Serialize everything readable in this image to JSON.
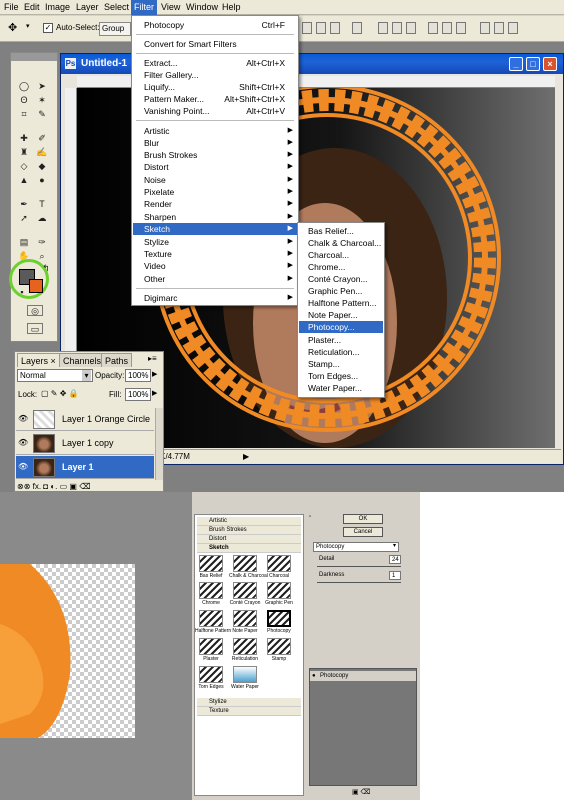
{
  "menubar": {
    "items": [
      "File",
      "Edit",
      "Image",
      "Layer",
      "Select",
      "Filter",
      "View",
      "Window",
      "Help"
    ],
    "active": "Filter"
  },
  "options": {
    "auto_select_label": "Auto-Select:",
    "auto_select_checked": true,
    "group_value": "Group"
  },
  "document": {
    "title": "Untitled-1",
    "status": "2.1K/4.77M"
  },
  "filter_menu": {
    "top": [
      {
        "label": "Photocopy",
        "shortcut": "Ctrl+F"
      },
      {
        "label": "Convert for Smart Filters",
        "shortcut": ""
      },
      {
        "label": "Extract...",
        "shortcut": "Alt+Ctrl+X"
      },
      {
        "label": "Filter Gallery...",
        "shortcut": ""
      },
      {
        "label": "Liquify...",
        "shortcut": "Shift+Ctrl+X"
      },
      {
        "label": "Pattern Maker...",
        "shortcut": "Alt+Shift+Ctrl+X"
      },
      {
        "label": "Vanishing Point...",
        "shortcut": "Alt+Ctrl+V"
      }
    ],
    "groups": [
      "Artistic",
      "Blur",
      "Brush Strokes",
      "Distort",
      "Noise",
      "Pixelate",
      "Render",
      "Sharpen",
      "Sketch",
      "Stylize",
      "Texture",
      "Video",
      "Other"
    ],
    "highlighted": "Sketch",
    "bottom": "Digimarc"
  },
  "sketch_submenu": {
    "items": [
      "Bas Relief...",
      "Chalk & Charcoal...",
      "Charcoal...",
      "Chrome...",
      "Conté Crayon...",
      "Graphic Pen...",
      "Halftone Pattern...",
      "Note Paper...",
      "Photocopy...",
      "Plaster...",
      "Reticulation...",
      "Stamp...",
      "Torn Edges...",
      "Water Paper..."
    ],
    "highlighted": "Photocopy..."
  },
  "layers_panel": {
    "tabs": [
      "Layers ×",
      "Channels",
      "Paths"
    ],
    "blend_mode": "Normal",
    "opacity_label": "Opacity:",
    "opacity": "100%",
    "lock_label": "Lock:",
    "fill_label": "Fill:",
    "fill": "100%",
    "layers": [
      {
        "name": "Layer 1 Orange Circle",
        "selected": false
      },
      {
        "name": "Layer 1 copy",
        "selected": false
      },
      {
        "name": "Layer 1",
        "selected": true
      }
    ],
    "footer_icons": "⊗⊗ fx. ◘ ◐. ▭ ▣ ⌫"
  },
  "gallery": {
    "categories_top": [
      "Artistic",
      "Brush Strokes",
      "Distort",
      "Sketch"
    ],
    "categories_bottom": [
      "Stylize",
      "Texture"
    ],
    "thumbs": [
      "Bas Relief",
      "Chalk & Charcoal",
      "Charcoal",
      "Chrome",
      "Conté Crayon",
      "Graphic Pen",
      "Halftone Pattern",
      "Note Paper",
      "Photocopy",
      "Plaster",
      "Reticulation",
      "Stamp",
      "Torn Edges",
      "Water Paper"
    ]
  },
  "dialog": {
    "ok": "OK",
    "cancel": "Cancel",
    "filter_select": "Photocopy",
    "detail_label": "Detail",
    "detail_value": "24",
    "darkness_label": "Darkness",
    "darkness_value": "1",
    "layer_entry": "Photocopy"
  },
  "colors": {
    "accent": "#316ac5",
    "foreground_swatch": "#5a5a5a",
    "background_swatch": "#e6631f",
    "orange": "#f08a24"
  }
}
